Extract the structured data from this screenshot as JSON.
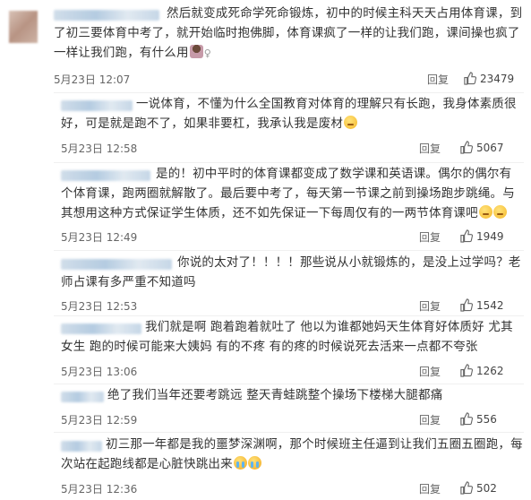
{
  "comments": [
    {
      "text": "然后就变成死命学死命锻炼，初中的时候主科天天占用体育课，到了初三要体育中考了，就开始临时抱佛脚，体育课疯了一样的让我们跑，课间操也疯了一样让我们跑，有什么用",
      "time": "5月23日 12:07",
      "reply_label": "回复",
      "likes": "23479",
      "emojis": [
        "woman-shrugging-icon",
        "female-sign-icon"
      ]
    },
    {
      "text": "一说体育，不懂为什么全国教育对体育的理解只有长跑，我身体素质很好，可是就是跑不了，如果非要杠，我承认我是废材",
      "time": "5月23日 12:58",
      "reply_label": "回复",
      "likes": "5067",
      "emojis": [
        "thinking-face-icon"
      ]
    },
    {
      "text": "是的！初中平时的体育课都变成了数学课和英语课。偶尔的偶尔有个体育课，跑两圈就解散了。最后要中考了，每天第一节课之前到操场跑步跳绳。与其想用这种方式保证学生体质，还不如先保证一下每周仅有的一两节体育课吧",
      "time": "5月23日 12:49",
      "reply_label": "回复",
      "likes": "1949",
      "emojis": [
        "thinking-face-icon",
        "thinking-face-icon"
      ]
    },
    {
      "text": "你说的太对了！！！！那些说从小就锻炼的，是没上过学吗？老师占课有多严重不知道吗",
      "time": "5月23日 12:53",
      "reply_label": "回复",
      "likes": "1542",
      "emojis": []
    },
    {
      "text": "我们就是啊 跑着跑着就吐了 他以为谁都她妈天生体育好体质好 尤其女生 跑的时候可能来大姨妈 有的不疼 有的疼的时候说死去活来一点都不夸张",
      "time": "5月23日 13:06",
      "reply_label": "回复",
      "likes": "1262",
      "emojis": []
    },
    {
      "text": "绝了我们当年还要考跳远  整天青蛙跳整个操场下楼梯大腿都痛",
      "time": "5月23日 12:59",
      "reply_label": "回复",
      "likes": "556",
      "emojis": []
    },
    {
      "text": "初三那一年都是我的噩梦深渊啊，那个时候班主任逼到让我们五圈五圈跑，每次站在起跑线都是心脏快跳出来",
      "time": "5月23日 12:36",
      "reply_label": "回复",
      "likes": "502",
      "emojis": [
        "loudly-crying-face-icon",
        "loudly-crying-face-icon"
      ]
    }
  ],
  "colors": {
    "text": "#333333",
    "meta": "#666666",
    "separator": "#f0f0f0",
    "username_blur": "#a8c3dc"
  }
}
